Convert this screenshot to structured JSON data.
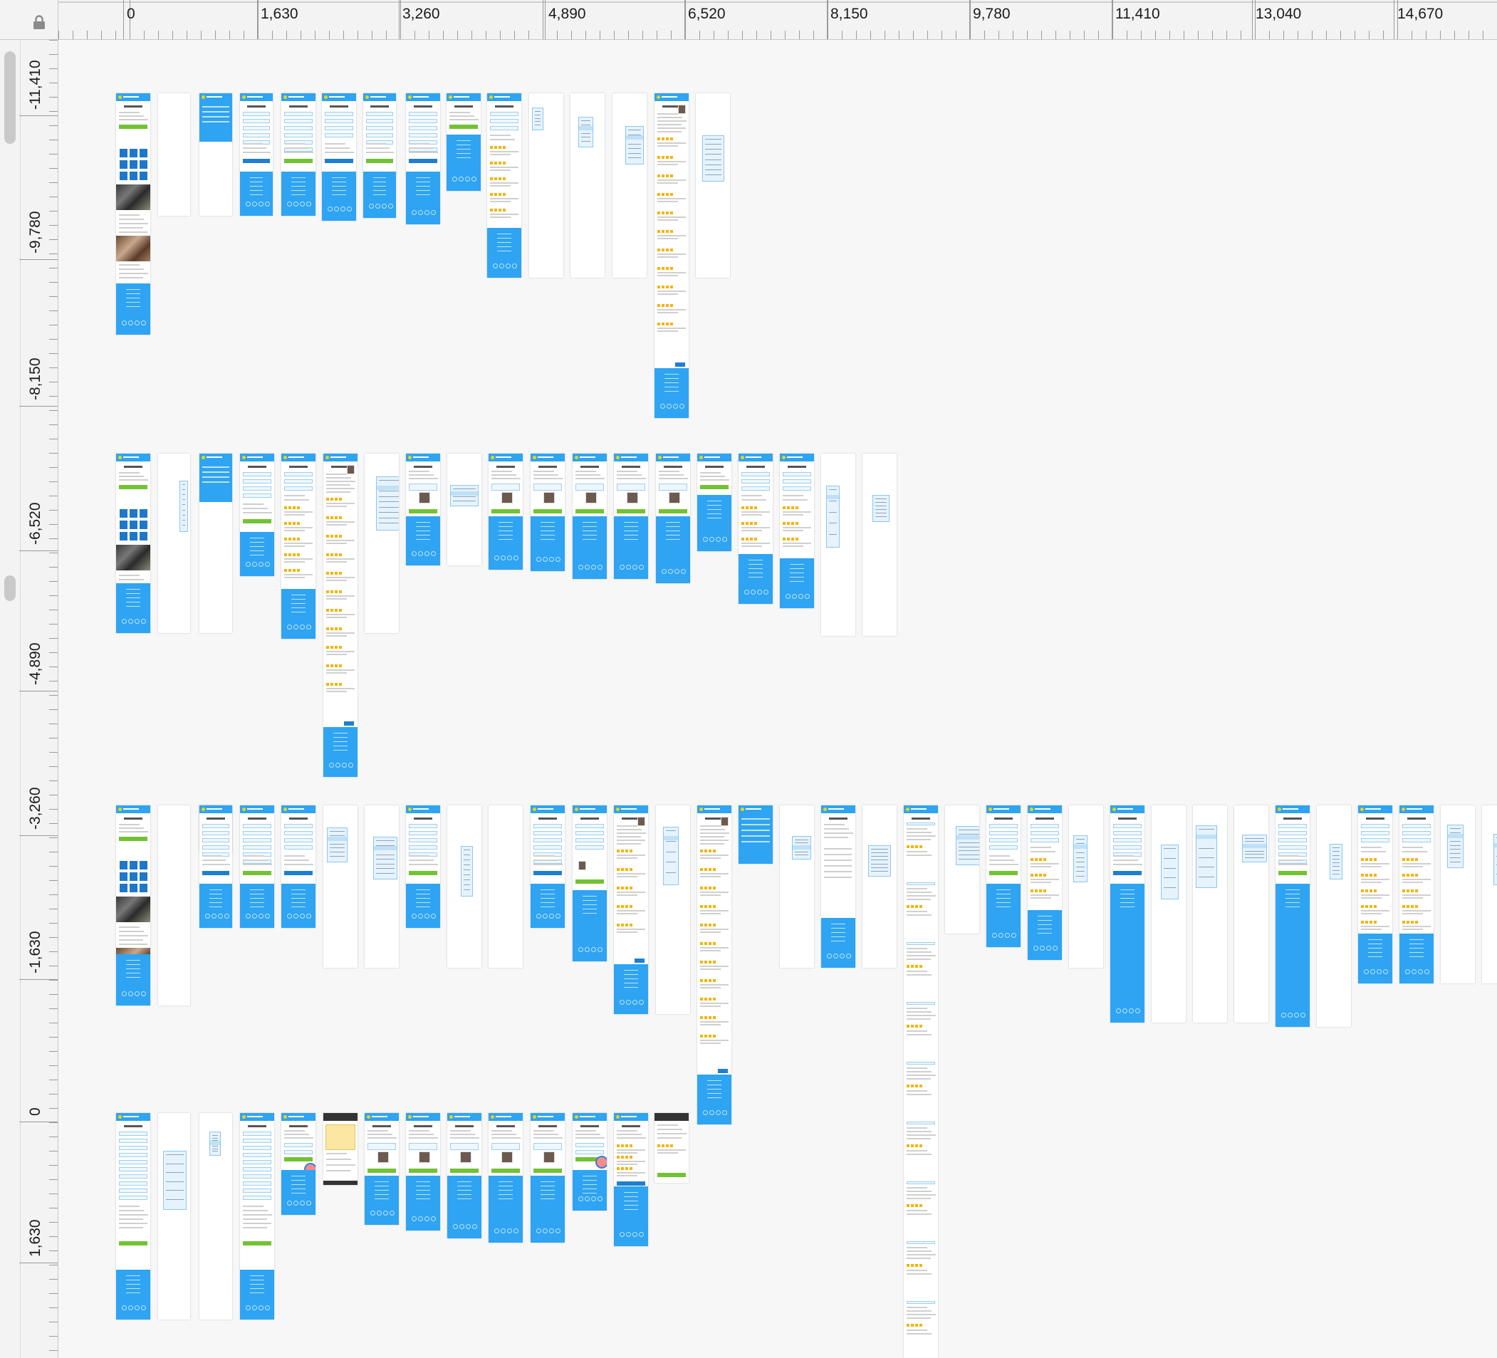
{
  "rulers": {
    "horizontal_labels": [
      "0",
      "1,630",
      "3,260",
      "4,890",
      "6,520",
      "8,150",
      "9,780",
      "11,410",
      "13,040",
      "14,670"
    ],
    "vertical_labels": [
      "-11,410",
      "-9,780",
      "-8,150",
      "-6,520",
      "-4,890",
      "-3,260",
      "-1,630",
      "0",
      "1,630"
    ]
  },
  "colors": {
    "brand_blue": "#2ea4f2",
    "cta_green": "#72c234",
    "cta_blue": "#1f7ed0",
    "rating_star": "#f4b400",
    "dropdown_bg": "#e6f3fd",
    "note_yellow": "#fbe6a2"
  },
  "icons": {
    "ruler_lock": "lock-icon"
  },
  "artboard_rows": [
    {
      "name": "row-1",
      "artboard_count": 15
    },
    {
      "name": "row-2",
      "artboard_count": 19
    },
    {
      "name": "row-3",
      "artboard_count": 35
    },
    {
      "name": "row-4",
      "artboard_count": 14
    }
  ]
}
